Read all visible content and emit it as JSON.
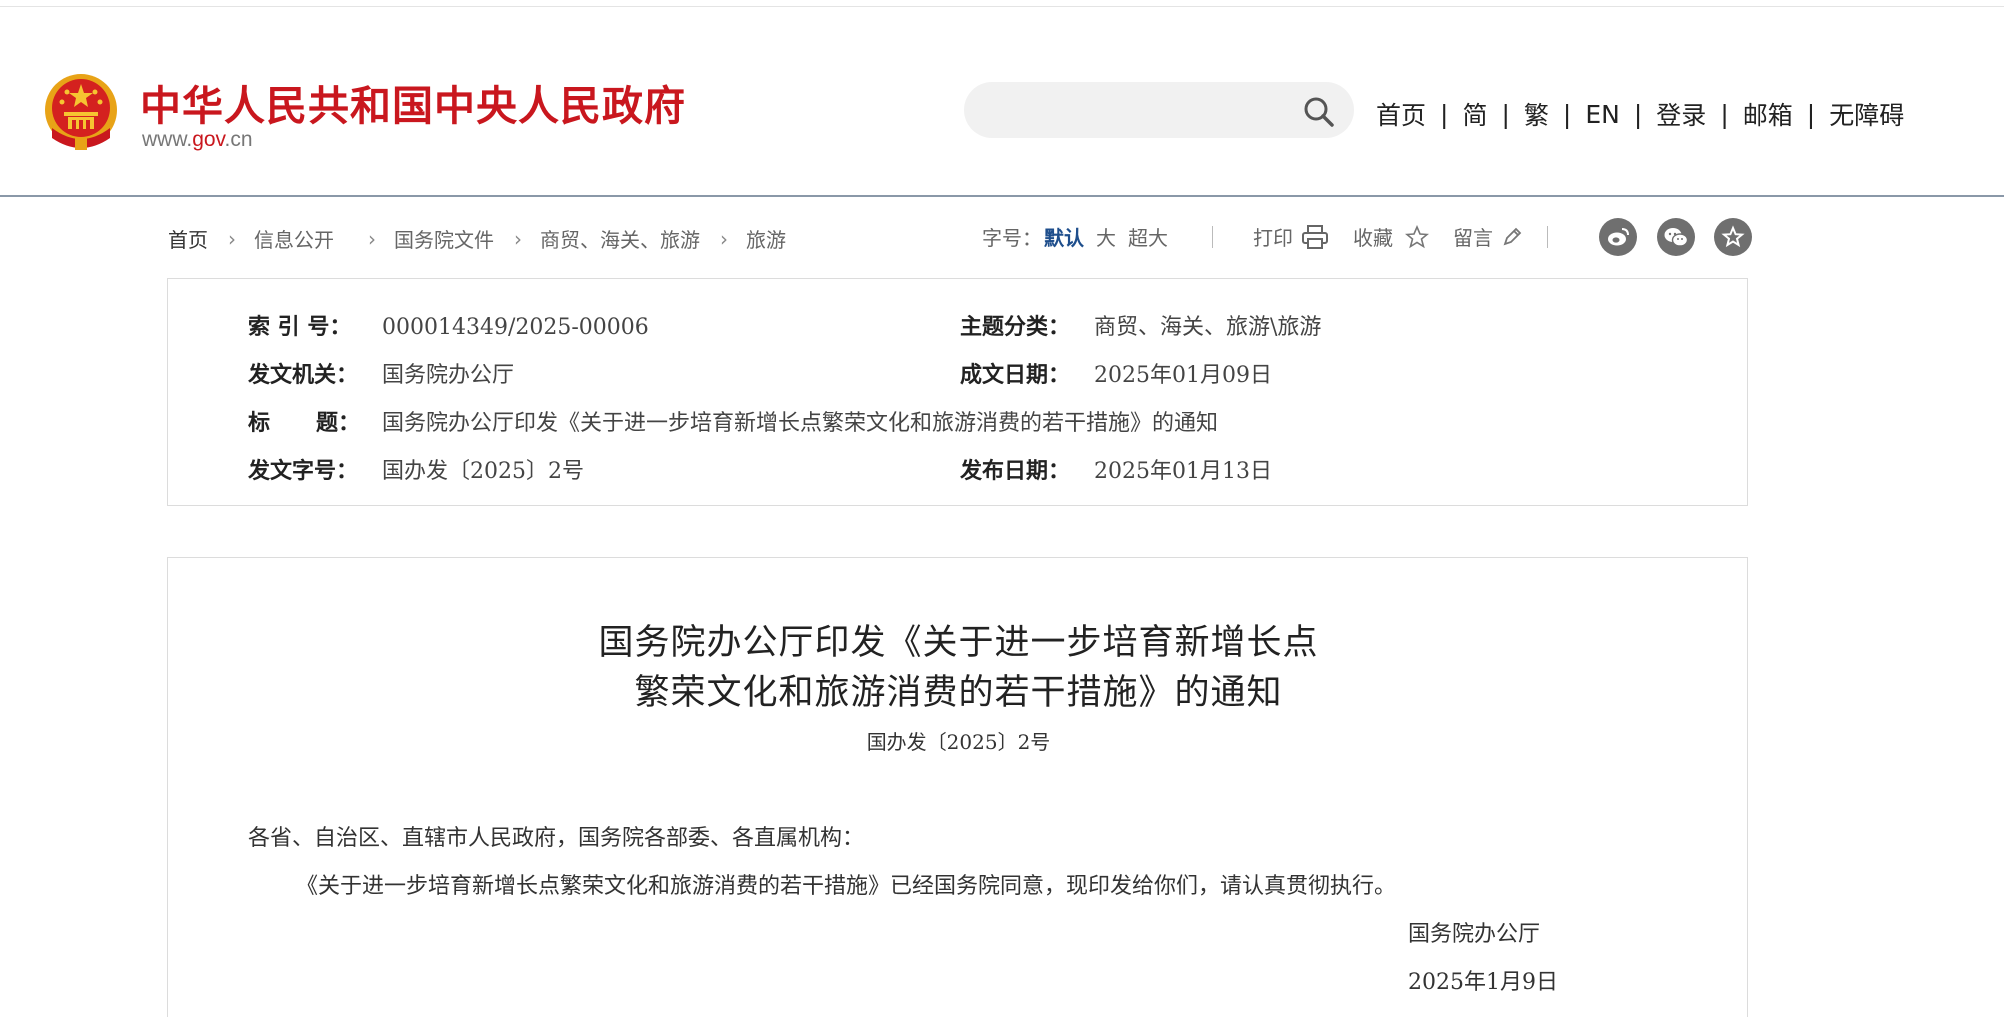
{
  "header": {
    "site_title": "中华人民共和国中央人民政府",
    "domain_prefix": "www.",
    "domain_gov": "gov",
    "domain_suffix": ".cn",
    "search_placeholder": "",
    "nav": [
      "首页",
      "简",
      "繁",
      "EN",
      "登录",
      "邮箱",
      "无障碍"
    ],
    "nav_separator": "|"
  },
  "breadcrumb": [
    "首页",
    "信息公开",
    "国务院文件",
    "商贸、海关、旅游",
    "旅游"
  ],
  "tools": {
    "font_size_label": "字号：",
    "font_sizes": [
      "默认",
      "大",
      "超大"
    ],
    "print_label": "打印",
    "favorite_label": "收藏",
    "comment_label": "留言"
  },
  "share_icons": [
    "weibo-icon",
    "wechat-icon",
    "star-circle-icon"
  ],
  "meta": {
    "index_label": "索  引  号：",
    "index_value": "000014349/2025-00006",
    "topic_label": "主题分类：",
    "topic_value": "商贸、海关、旅游\\旅游",
    "issuer_label": "发文机关：",
    "issuer_value": "国务院办公厅",
    "created_label": "成文日期：",
    "created_value": "2025年01月09日",
    "title_label": "标      题：",
    "title_value": "国务院办公厅印发《关于进一步培育新增长点繁荣文化和旅游消费的若干措施》的通知",
    "docno_label": "发文字号：",
    "docno_value": "国办发〔2025〕2号",
    "published_label": "发布日期：",
    "published_value": "2025年01月13日"
  },
  "article": {
    "title_line1": "国务院办公厅印发《关于进一步培育新增长点",
    "title_line2": "繁荣文化和旅游消费的若干措施》的通知",
    "doc_number": "国办发〔2025〕2号",
    "salutation": "各省、自治区、直辖市人民政府，国务院各部委、各直属机构：",
    "body": "《关于进一步培育新增长点繁荣文化和旅游消费的若干措施》已经国务院同意，现印发给你们，请认真贯彻执行。",
    "signature": "国务院办公厅",
    "date": "2025年1月9日"
  },
  "colors": {
    "brand_red": "#c9171e",
    "active_blue": "#1e4e8c",
    "header_rule": "#8a98a8"
  }
}
